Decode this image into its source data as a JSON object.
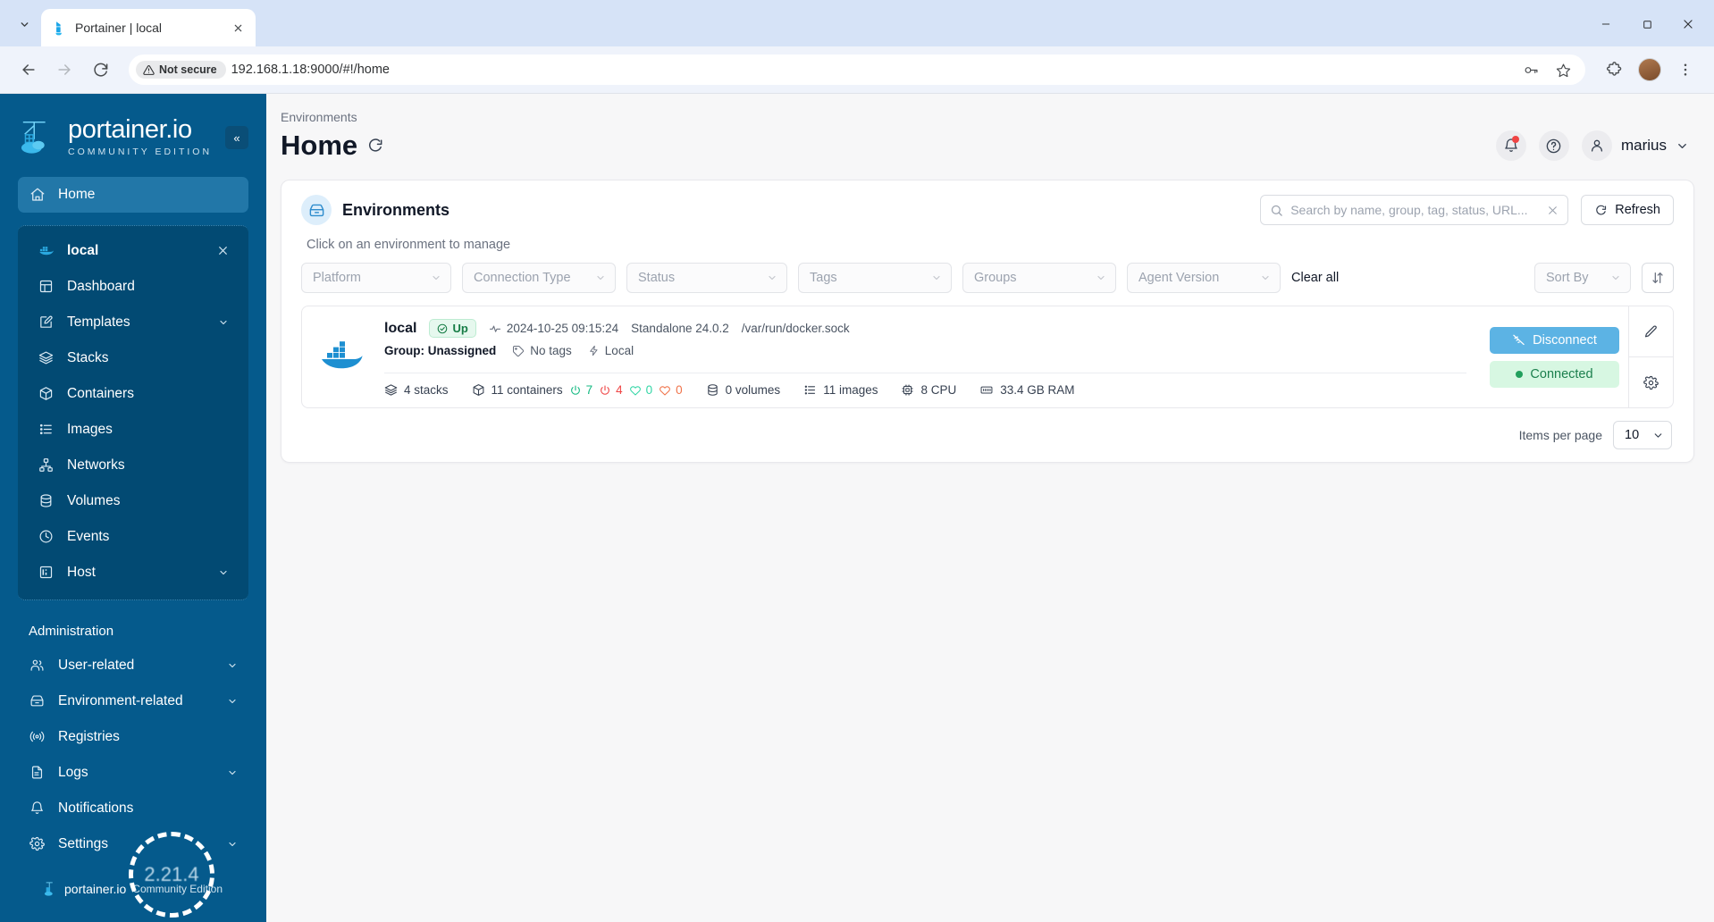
{
  "browser": {
    "tab_title": "Portainer | local",
    "tab_favicon": "portainer-icon",
    "url": "192.168.1.18:9000/#!/home",
    "security_label": "Not secure",
    "back_icon": "back-arrow-icon",
    "forward_icon": "forward-arrow-icon",
    "reload_icon": "reload-icon",
    "password_icon": "password-key-icon",
    "bookmark_icon": "star-icon",
    "extensions_icon": "puzzle-icon",
    "menu_icon": "kebab-menu-icon",
    "minimize_icon": "minimize-icon",
    "maximize_icon": "maximize-icon",
    "close_icon": "window-close-icon"
  },
  "sidebar": {
    "brand": "portainer.io",
    "edition": "COMMUNITY EDITION",
    "collapse_label": "«",
    "home": {
      "label": "Home",
      "icon": "home-icon"
    },
    "environment": {
      "name": "local",
      "icon": "docker-whale-icon",
      "close_icon": "close-icon",
      "items": [
        {
          "label": "Dashboard",
          "icon": "dashboard-icon",
          "chevron": false
        },
        {
          "label": "Templates",
          "icon": "templates-edit-icon",
          "chevron": true
        },
        {
          "label": "Stacks",
          "icon": "stacks-layers-icon",
          "chevron": false
        },
        {
          "label": "Containers",
          "icon": "containers-box-icon",
          "chevron": false
        },
        {
          "label": "Images",
          "icon": "images-list-icon",
          "chevron": false
        },
        {
          "label": "Networks",
          "icon": "networks-nodes-icon",
          "chevron": false
        },
        {
          "label": "Volumes",
          "icon": "volumes-database-icon",
          "chevron": false
        },
        {
          "label": "Events",
          "icon": "events-clock-icon",
          "chevron": false
        },
        {
          "label": "Host",
          "icon": "host-server-icon",
          "chevron": true
        }
      ]
    },
    "administration_title": "Administration",
    "admin_items": [
      {
        "label": "User-related",
        "icon": "users-icon",
        "chevron": true
      },
      {
        "label": "Environment-related",
        "icon": "environment-box-icon",
        "chevron": true
      },
      {
        "label": "Registries",
        "icon": "registries-broadcast-icon",
        "chevron": false
      },
      {
        "label": "Logs",
        "icon": "logs-document-icon",
        "chevron": true
      },
      {
        "label": "Notifications",
        "icon": "bell-icon",
        "chevron": false
      },
      {
        "label": "Settings",
        "icon": "gear-icon",
        "chevron": true
      }
    ],
    "footer": {
      "brand": "portainer.io",
      "edition": "Community Edition",
      "version": "2.21.4"
    }
  },
  "header": {
    "breadcrumb": "Environments",
    "title": "Home",
    "refresh_icon": "refresh-icon",
    "notifications_icon": "bell-icon",
    "help_icon": "help-circle-icon",
    "avatar_icon": "user-avatar-icon",
    "user_name": "marius",
    "user_chevron_icon": "chevron-down-icon"
  },
  "panel": {
    "title": "Environments",
    "title_icon": "environment-box-icon",
    "hint": "Click on an environment to manage",
    "search": {
      "placeholder": "Search by name, group, tag, status, URL...",
      "value": "",
      "search_icon": "search-icon",
      "clear_icon": "close-icon"
    },
    "refresh_button": {
      "label": "Refresh",
      "icon": "refresh-icon"
    },
    "filters": [
      {
        "label": "Platform",
        "name": "platform"
      },
      {
        "label": "Connection Type",
        "name": "connection-type"
      },
      {
        "label": "Status",
        "name": "status"
      },
      {
        "label": "Tags",
        "name": "tags"
      },
      {
        "label": "Groups",
        "name": "groups"
      },
      {
        "label": "Agent Version",
        "name": "agent-version"
      }
    ],
    "clear_all": "Clear all",
    "sort_by": "Sort By",
    "sort_direction_icon": "sort-updown-icon",
    "items_per_page_label": "Items per page",
    "items_per_page_value": "10"
  },
  "environment_card": {
    "logo_icon": "docker-whale-icon",
    "name": "local",
    "status_badge": "Up",
    "status_icon": "check-circle-icon",
    "heartbeat_icon": "activity-pulse-icon",
    "last_checkin": "2024-10-25 09:15:24",
    "engine": "Standalone 24.0.2",
    "socket": "/var/run/docker.sock",
    "group": "Group: Unassigned",
    "tags": "No tags",
    "tags_icon": "tag-icon",
    "connection": "Local",
    "connection_icon": "bolt-icon",
    "stats": {
      "stacks": {
        "value": "4 stacks",
        "icon": "stacks-layers-icon"
      },
      "containers": {
        "value": "11 containers",
        "icon": "containers-box-icon"
      },
      "running": "7",
      "stopped": "4",
      "healthy": "0",
      "unhealthy": "0",
      "volumes": {
        "value": "0 volumes",
        "icon": "volumes-database-icon"
      },
      "images": {
        "value": "11 images",
        "icon": "images-list-icon"
      },
      "cpu": {
        "value": "8 CPU",
        "icon": "cpu-icon"
      },
      "ram": {
        "value": "33.4 GB RAM",
        "icon": "memory-icon"
      }
    },
    "disconnect_button": {
      "label": "Disconnect",
      "icon": "disconnect-icon"
    },
    "connected_chip": "Connected",
    "edit_icon": "pencil-edit-icon",
    "settings_icon": "gear-icon"
  },
  "colors": {
    "sidebar": "#055a8c",
    "sidebar_active": "#2277a8",
    "accent_blue": "#5cb3e4",
    "status_up_bg": "#e6f8ee",
    "status_up_text": "#167c45",
    "connected_bg": "#d7f7e2",
    "connected_text": "#1b7f4d",
    "running_green": "#13b981",
    "stopped_red": "#ef4444"
  }
}
